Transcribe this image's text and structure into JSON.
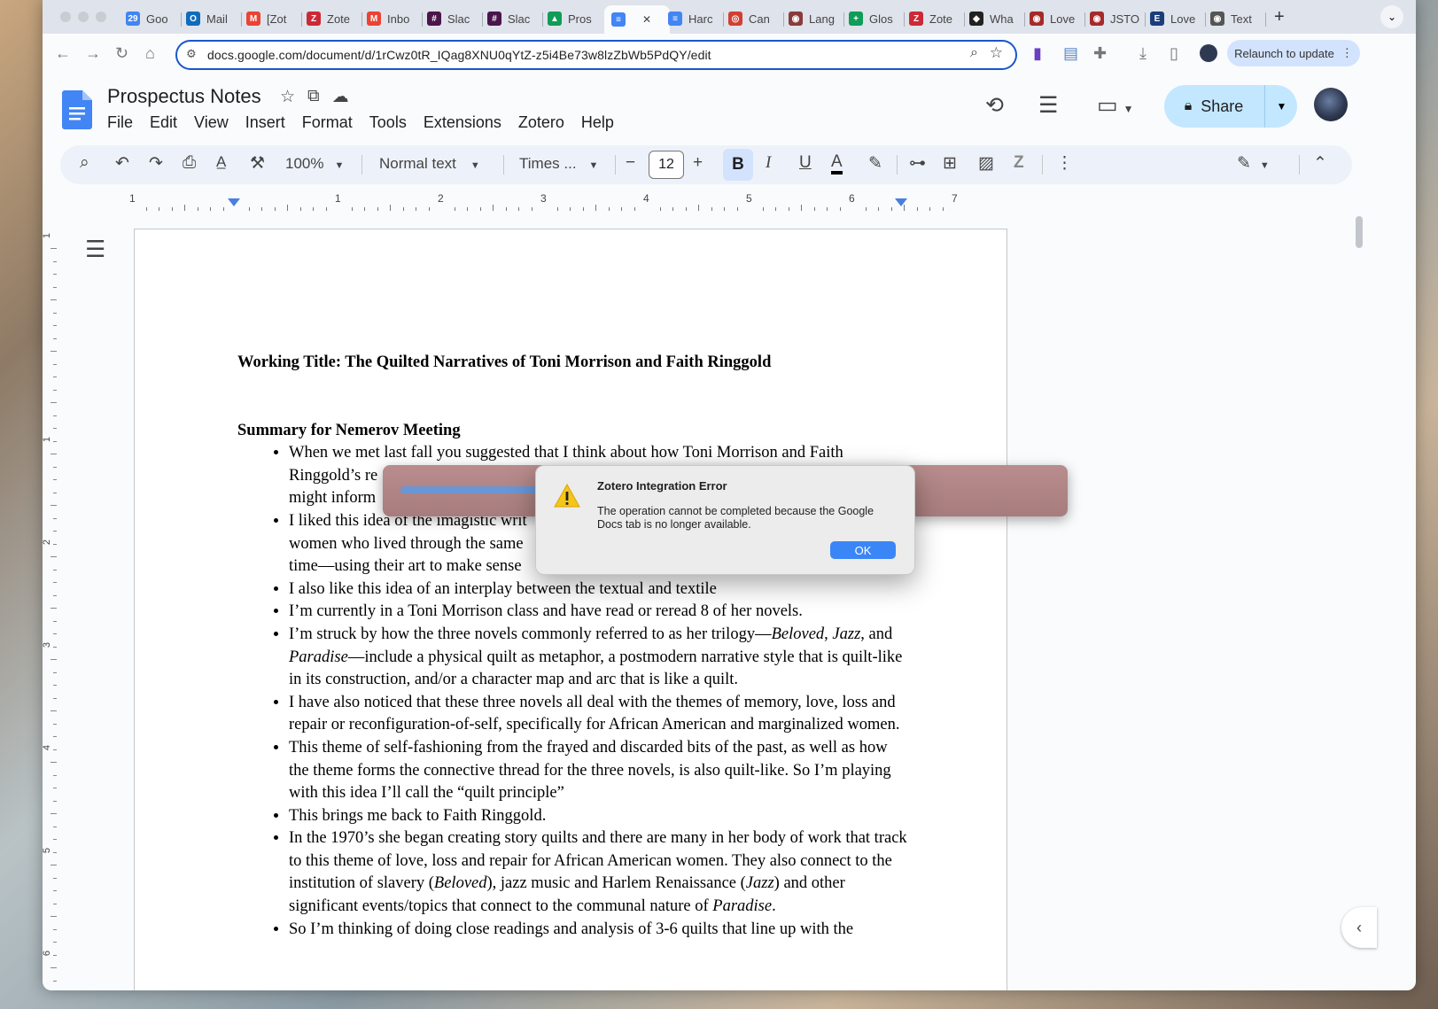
{
  "browser": {
    "tabs": [
      {
        "label": "Goo",
        "fav": "29",
        "color": "#4285f4"
      },
      {
        "label": "Mail",
        "fav": "O",
        "color": "#0f6cbd"
      },
      {
        "label": "[Zot",
        "fav": "M",
        "color": "#ea4335"
      },
      {
        "label": "Zote",
        "fav": "Z",
        "color": "#cc2936"
      },
      {
        "label": "Inbo",
        "fav": "M",
        "color": "#ea4335"
      },
      {
        "label": "Slac",
        "fav": "#",
        "color": "#4a154b"
      },
      {
        "label": "Slac",
        "fav": "#",
        "color": "#4a154b"
      },
      {
        "label": "Pros",
        "fav": "▲",
        "color": "#0f9d58"
      },
      {
        "label": "",
        "fav": "≡",
        "color": "#4285f4",
        "active": true
      },
      {
        "label": "Harc",
        "fav": "≡",
        "color": "#4285f4"
      },
      {
        "label": "Can",
        "fav": "◎",
        "color": "#d23f31"
      },
      {
        "label": "Lang",
        "fav": "◉",
        "color": "#8a3b3b"
      },
      {
        "label": "Glos",
        "fav": "+",
        "color": "#0f9d58"
      },
      {
        "label": "Zote",
        "fav": "Z",
        "color": "#cc2936"
      },
      {
        "label": "Wha",
        "fav": "◆",
        "color": "#222222"
      },
      {
        "label": "Love",
        "fav": "◉",
        "color": "#a52a2a"
      },
      {
        "label": "JSTO",
        "fav": "◉",
        "color": "#a52a2a"
      },
      {
        "label": "Love",
        "fav": "E",
        "color": "#1a3d7c"
      },
      {
        "label": "Text",
        "fav": "◉",
        "color": "#555555"
      }
    ],
    "url": "docs.google.com/document/d/1rCwz0tR_IQag8XNU0qYtZ-z5i4Be73w8lzZbWb5PdQY/edit",
    "relaunch_label": "Relaunch to update"
  },
  "docs": {
    "title": "Prospectus Notes",
    "menu": [
      "File",
      "Edit",
      "View",
      "Insert",
      "Format",
      "Tools",
      "Extensions",
      "Zotero",
      "Help"
    ],
    "share_label": "Share",
    "toolbar": {
      "zoom": "100%",
      "style": "Normal text",
      "font": "Times ...",
      "font_size": "12",
      "bold": "B",
      "italic": "I",
      "underline": "U",
      "text_color": "A"
    },
    "ruler_numbers": [
      "1",
      "1",
      "2",
      "3",
      "4",
      "5",
      "6",
      "7"
    ],
    "vruler_numbers": [
      "1",
      "1",
      "2",
      "3",
      "4",
      "5",
      "6"
    ]
  },
  "document": {
    "working_title": "Working Title: The Quilted Narratives of Toni Morrison and Faith Ringgold",
    "section_heading": "Summary for Nemerov Meeting",
    "bullets": [
      "When we met last fall you suggested that I think about how Toni Morrison and Faith Ringgold’s re",
      "might inform",
      "I liked this idea of the imagistic writ",
      "women who lived through the same",
      "time—using their art to make sense",
      "I also like this idea of an interplay between the textual and textile",
      "I’m currently in a Toni Morrison class and have read or reread 8 of her novels.",
      "I’m struck by how the three novels commonly referred to as her trilogy—Beloved, Jazz, and Paradise—include a physical quilt as metaphor, a postmodern narrative style that is quilt-like in its construction, and/or a character map and arc that is like a quilt.",
      "I have also noticed that these three novels all deal with the themes of memory, love, loss and repair or reconfiguration-of-self, specifically for African American and marginalized women.",
      "This theme of self-fashioning from the frayed and discarded bits of the past, as well as how the theme forms the connective thread for the three novels, is also quilt-like. So I’m playing with this idea I’ll call the “quilt principle”",
      "This brings me back to Faith Ringgold.",
      "In the 1970’s she began creating story quilts and there are many in her body of work that track to this theme of love, loss and repair for African American women. They also connect to the institution of slavery (Beloved), jazz music and Harlem Renaissance (Jazz) and other significant events/topics that connect to the communal nature of Paradise.",
      "So I’m thinking of doing close readings and analysis of 3-6 quilts that line up with the"
    ]
  },
  "dialog": {
    "title": "Zotero Integration Error",
    "message": "The operation cannot be completed because the Google Docs tab is no longer available.",
    "ok_label": "OK"
  }
}
